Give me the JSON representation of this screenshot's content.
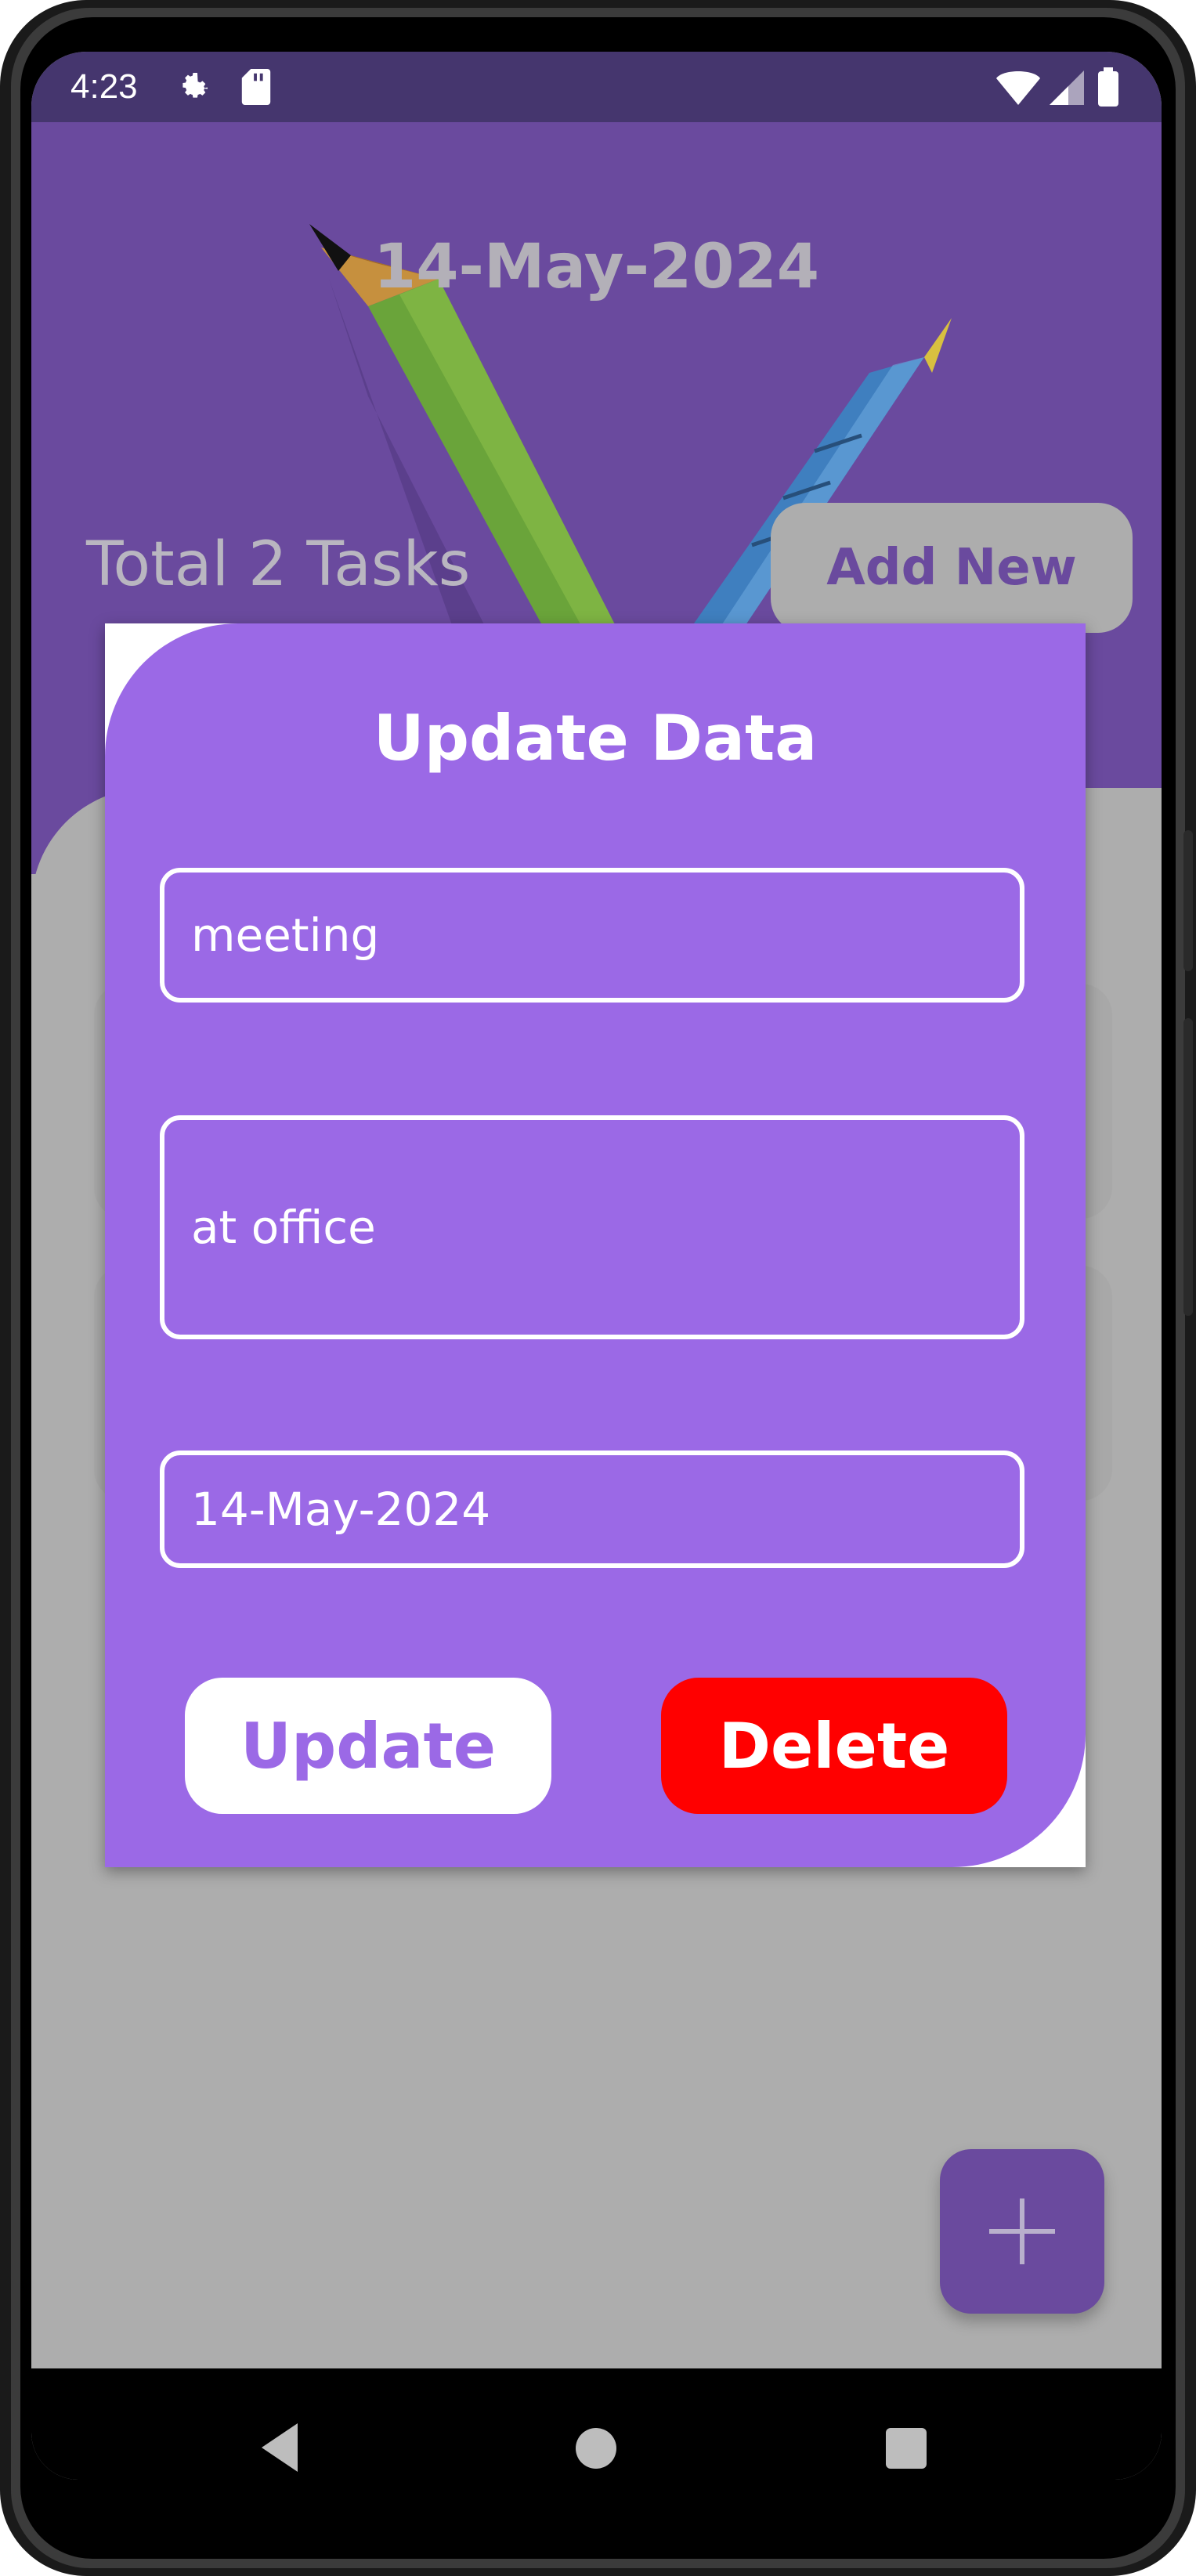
{
  "status_bar": {
    "time": "4:23",
    "icons": [
      "gear-icon",
      "sd-card-icon",
      "wifi-icon",
      "signal-icon",
      "battery-icon"
    ]
  },
  "header": {
    "date": "14-May-2024",
    "total_tasks": "Total 2 Tasks",
    "add_new_label": "Add New"
  },
  "dialog": {
    "title": "Update Data",
    "title_field_value": "meeting",
    "description_field_value": "at office",
    "date_field_value": "14-May-2024",
    "update_label": "Update",
    "delete_label": "Delete"
  },
  "fab": {
    "icon": "plus-icon"
  },
  "nav_bar": {
    "icons": [
      "back-icon",
      "home-icon",
      "recents-icon"
    ]
  },
  "colors": {
    "status_bar": "#45366e",
    "header": "#6a4a9e",
    "dialog": "#9b69e6",
    "background": "#adadad",
    "delete": "#ff0000",
    "white": "#ffffff"
  }
}
